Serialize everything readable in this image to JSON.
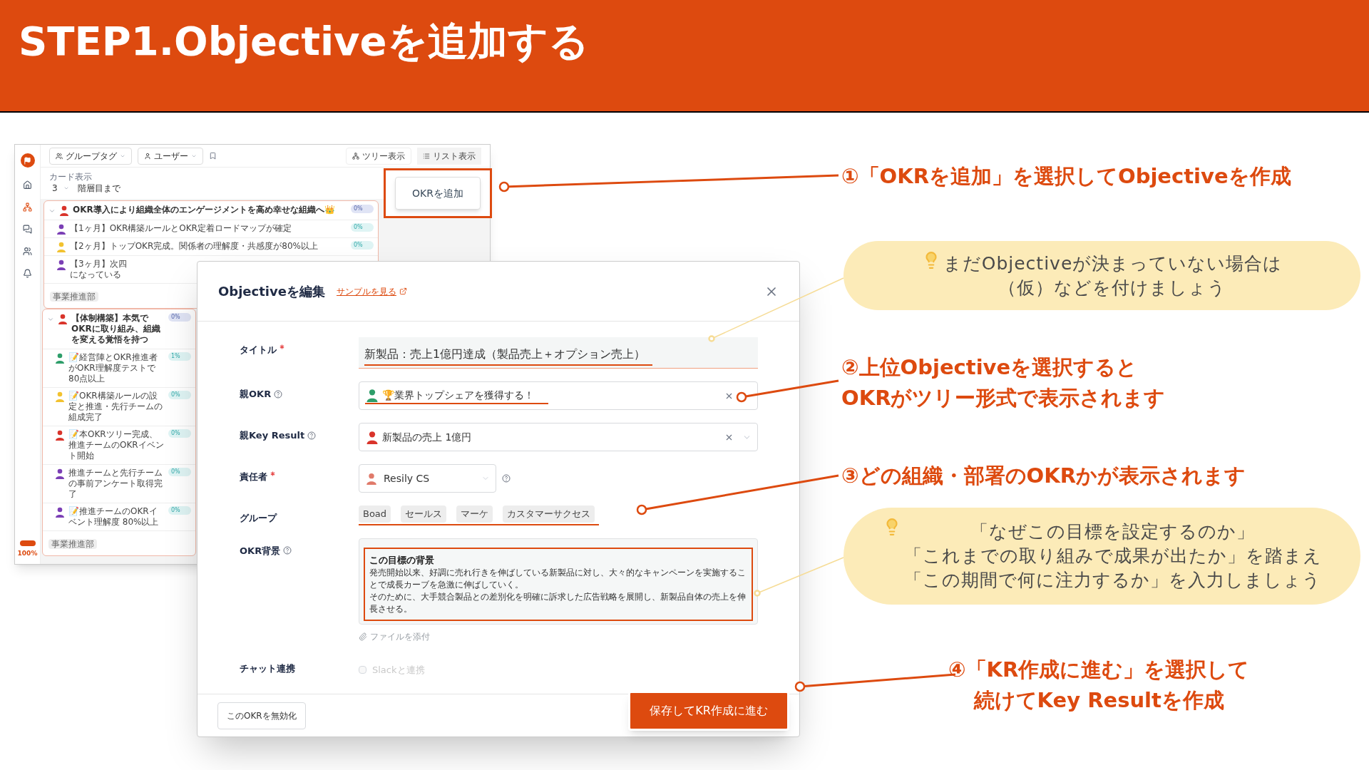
{
  "slide_title": "STEP1.Objectiveを追加する",
  "app": {
    "filters": [
      "グループタグ",
      "ユーザー"
    ],
    "views": [
      {
        "label": "ツリー表示",
        "selected": true
      },
      {
        "label": "リスト表示",
        "selected": false
      }
    ],
    "card_display": {
      "label": "カード表示",
      "value": "3",
      "suffix": "階層目まで"
    },
    "add_button": "OKRを追加",
    "cards": [
      {
        "objective": {
          "text": "OKR導入により組織全体のエンゲージメントを高め幸せな組織へ👑",
          "progress": "0%",
          "color": "#d9342b"
        },
        "key_results": [
          {
            "lines": [
              "【1ヶ月】OKR構築ルールとOKR定着ロードマップが確定"
            ],
            "progress": "0%",
            "color": "#7b3fb5"
          },
          {
            "lines": [
              "【2ヶ月】トップOKR完成。関係者の理解度・共感度が80%以上"
            ],
            "progress": "0%",
            "color": "#f2c230"
          },
          {
            "lines": [
              "【3ヶ月】次四",
              "になっている"
            ],
            "color": "#7b3fb5"
          }
        ],
        "tag": "事業推進部"
      },
      {
        "objective": {
          "text": "【体制構築】本気でOKRに取り組み、組織を変える覚悟を持つ",
          "progress": "0%",
          "color": "#d9342b"
        },
        "key_results": [
          {
            "lines": [
              "📝経営陣とOKR推進者がOKR理解度テストで80点以上"
            ],
            "progress": "1%",
            "color": "#2e9e6a"
          },
          {
            "lines": [
              "📝OKR構築ルールの設定と推進・先行チームの組成完了"
            ],
            "progress": "0%",
            "color": "#f2c230"
          },
          {
            "lines": [
              "📝本OKRツリー完成、推進チームのOKRイベント開始"
            ],
            "progress": "0%",
            "color": "#d9342b"
          },
          {
            "lines": [
              "推進チームと先行チームの事前アンケート取得完了"
            ],
            "progress": "0%",
            "color": "#7b3fb5"
          },
          {
            "lines": [
              "📝推進チームのOKRイベント理解度 80%以上"
            ],
            "progress": "0%",
            "color": "#7b3fb5"
          }
        ],
        "tag": "事業推進部"
      }
    ],
    "zoom": "100%"
  },
  "modal": {
    "title": "Objectiveを編集",
    "sample_link": "サンプルを見る",
    "fields": [
      {
        "kind": "text",
        "label": "タイトル",
        "required": true,
        "value": "新製品：売上1億円達成（製品売上＋オプション売上）"
      },
      {
        "kind": "select",
        "label": "親OKR",
        "help": true,
        "value": "🏆業界トップシェアを獲得する！",
        "color": "#2e9e6a"
      },
      {
        "kind": "select",
        "label": "親Key Result",
        "help": true,
        "value": "新製品の売上 1億円",
        "color": "#d9342b"
      },
      {
        "kind": "owner",
        "label": "責任者",
        "required": true,
        "value": "Resily CS",
        "color": "#e07a6a"
      },
      {
        "kind": "tags",
        "label": "グループ",
        "tags": [
          "Boad",
          "セールス",
          "マーケ",
          "カスタマーサクセス"
        ]
      },
      {
        "kind": "richtext",
        "label": "OKR背景",
        "help": true,
        "heading": "この目標の背景",
        "paragraphs": [
          "発売開始以来、好調に売れ行きを伸ばしている新製品に対し、大々的なキャンペーンを実施することで成長カーブを急激に伸ばしていく。",
          "そのために、大手競合製品との差別化を明確に訴求した広告戦略を展開し、新製品自体の売上を伸長させる。"
        ],
        "attach": "ファイルを添付"
      },
      {
        "kind": "checkbox",
        "label": "チャット連携",
        "option": "Slackと連携",
        "checked": false,
        "disabled": true
      }
    ],
    "disable_button": "このOKRを無効化",
    "save_button": "保存してKR作成に進む"
  },
  "callouts": [
    {
      "kind": "step",
      "lines": [
        "①「OKRを追加」を選択してObjectiveを作成"
      ]
    },
    {
      "kind": "tip",
      "lines": [
        "まだObjectiveが決まっていない場合は",
        "（仮）などを付けましょう"
      ]
    },
    {
      "kind": "step",
      "lines": [
        "②上位Objectiveを選択すると",
        "OKRがツリー形式で表示されます"
      ]
    },
    {
      "kind": "step",
      "lines": [
        "③どの組織・部署のOKRかが表示されます"
      ]
    },
    {
      "kind": "tip",
      "lines": [
        "「なぜこの目標を設定するのか」",
        "「これまでの取り組みで成果が出たか」を踏まえ",
        "「この期間で何に注力するか」を入力しましょう"
      ]
    },
    {
      "kind": "step",
      "lines": [
        "④「KR作成に進む」を選択して",
        "続けてKey Resultを作成"
      ]
    }
  ]
}
